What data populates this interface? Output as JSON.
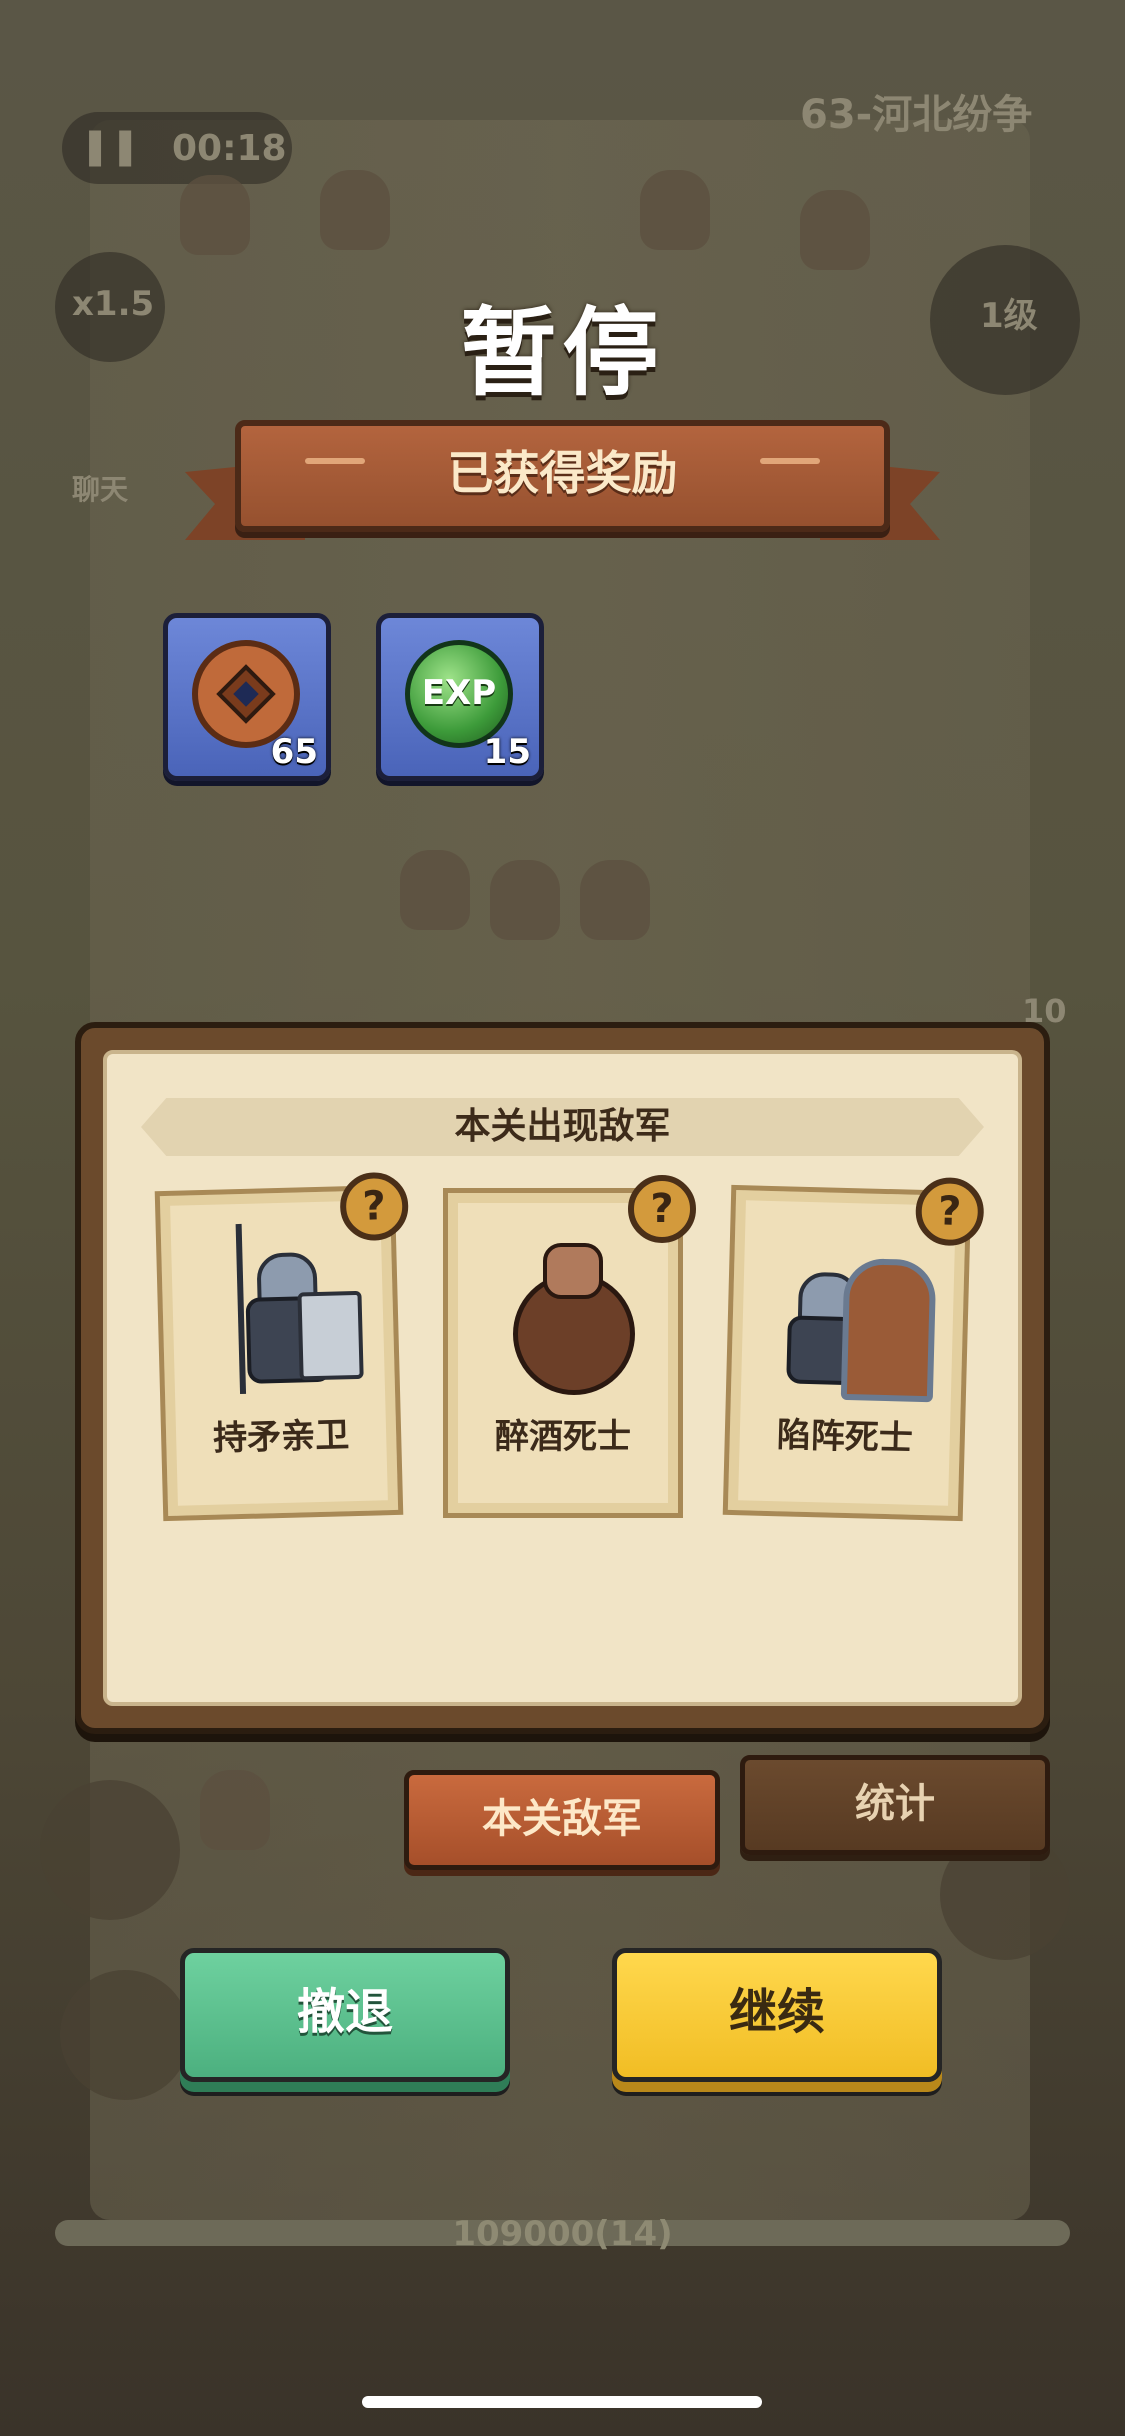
{
  "background": {
    "timer": "00:18",
    "speed": "x1.5",
    "chat_label": "聊天",
    "level_name": "63-河北纷争",
    "level_badge": "1级",
    "side_count": "10",
    "score": "109000(14)"
  },
  "pause_dialog": {
    "title": "暂停",
    "rewards_header": "已获得奖励",
    "rewards": [
      {
        "icon": "copper-coin-icon",
        "count": "65"
      },
      {
        "icon": "exp-orb-icon",
        "label": "EXP",
        "count": "15"
      }
    ],
    "enemy_panel": {
      "header": "本关出现敌军",
      "enemies": [
        {
          "name": "持矛亲卫",
          "icon": "spear-guard-icon"
        },
        {
          "name": "醉酒死士",
          "icon": "drunk-warrior-icon"
        },
        {
          "name": "陷阵死士",
          "icon": "shield-warrior-icon"
        }
      ],
      "help_glyph": "?"
    },
    "tabs": {
      "enemies": "本关敌军",
      "stats": "统计"
    },
    "buttons": {
      "retreat": "撤退",
      "continue": "继续"
    }
  },
  "colors": {
    "retreat": "#4cb07f",
    "continue": "#f1bd24",
    "ribbon": "#96512f",
    "panel_bg": "#f1e4c6"
  }
}
